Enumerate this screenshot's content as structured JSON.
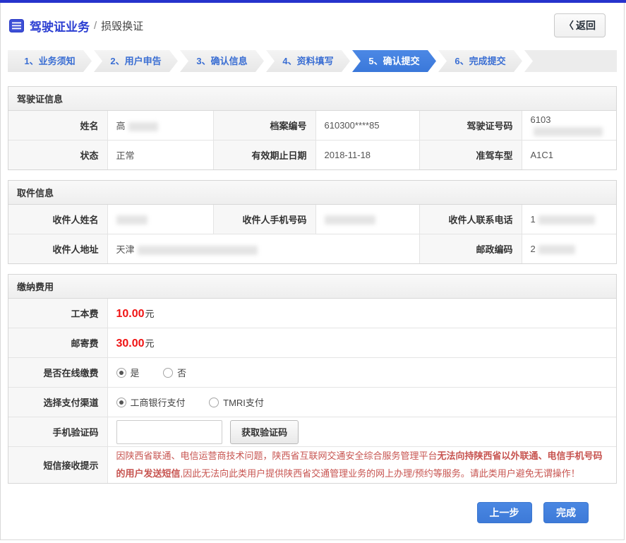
{
  "header": {
    "title": "驾驶证业务",
    "separator": "/",
    "subtitle": "损毁换证",
    "back_icon": "〈",
    "back_label": "返回"
  },
  "wizard": {
    "steps": [
      {
        "label": "1、业务须知",
        "active": false
      },
      {
        "label": "2、用户申告",
        "active": false
      },
      {
        "label": "3、确认信息",
        "active": false
      },
      {
        "label": "4、资料填写",
        "active": false
      },
      {
        "label": "5、确认提交",
        "active": true
      },
      {
        "label": "6、完成提交",
        "active": false
      }
    ]
  },
  "license": {
    "title": "驾驶证信息",
    "name_label": "姓名",
    "name_value_visible": "高",
    "file_no_label": "档案编号",
    "file_no_value": "610300****85",
    "license_no_label": "驾驶证号码",
    "license_no_value_visible": "6103",
    "status_label": "状态",
    "status_value": "正常",
    "expiry_label": "有效期止日期",
    "expiry_value": "2018-11-18",
    "vehicle_class_label": "准驾车型",
    "vehicle_class_value": "A1C1"
  },
  "pickup": {
    "title": "取件信息",
    "recipient_name_label": "收件人姓名",
    "recipient_name_value_visible": "",
    "recipient_mobile_label": "收件人手机号码",
    "recipient_mobile_value_visible": "",
    "recipient_phone_label": "收件人联系电话",
    "recipient_phone_value_visible": "1",
    "recipient_address_label": "收件人地址",
    "recipient_address_value_visible": "天津",
    "postcode_label": "邮政编码",
    "postcode_value_visible": "2"
  },
  "payment": {
    "title": "缴纳费用",
    "work_fee_label": "工本费",
    "work_fee_value": "10.00",
    "work_fee_unit": "元",
    "postage_label": "邮寄费",
    "postage_value": "30.00",
    "postage_unit": "元",
    "online_pay_label": "是否在线缴费",
    "online_yes_label": "是",
    "online_no_label": "否",
    "online_selected": "是",
    "channel_label": "选择支付渠道",
    "channel_icbc_label": "工商银行支付",
    "channel_tmri_label": "TMRI支付",
    "channel_selected": "工商银行支付",
    "captcha_label": "手机验证码",
    "captcha_input_value": "",
    "get_code_button_label": "获取验证码",
    "sms_tip_label": "短信接收提示",
    "sms_note_part1": "因陕西省联通、电信运营商技术问题，陕西省互联网交通安全综合服务管理平台",
    "sms_note_bold": "无法向持陕西省以外联通、电信手机号码的用户发送短信",
    "sms_note_part2": ",因此无法向此类用户提供陕西省交通管理业务的网上办理/预约等服务。请此类用户避免无谓操作！"
  },
  "footer": {
    "prev_label": "上一步",
    "finish_label": "完成"
  },
  "colors": {
    "accent_blue": "#3a78da",
    "title_blue": "#2c3fd2",
    "topbar_blue": "#2633cc",
    "fee_red": "#f01414",
    "note_red": "#c75450"
  }
}
